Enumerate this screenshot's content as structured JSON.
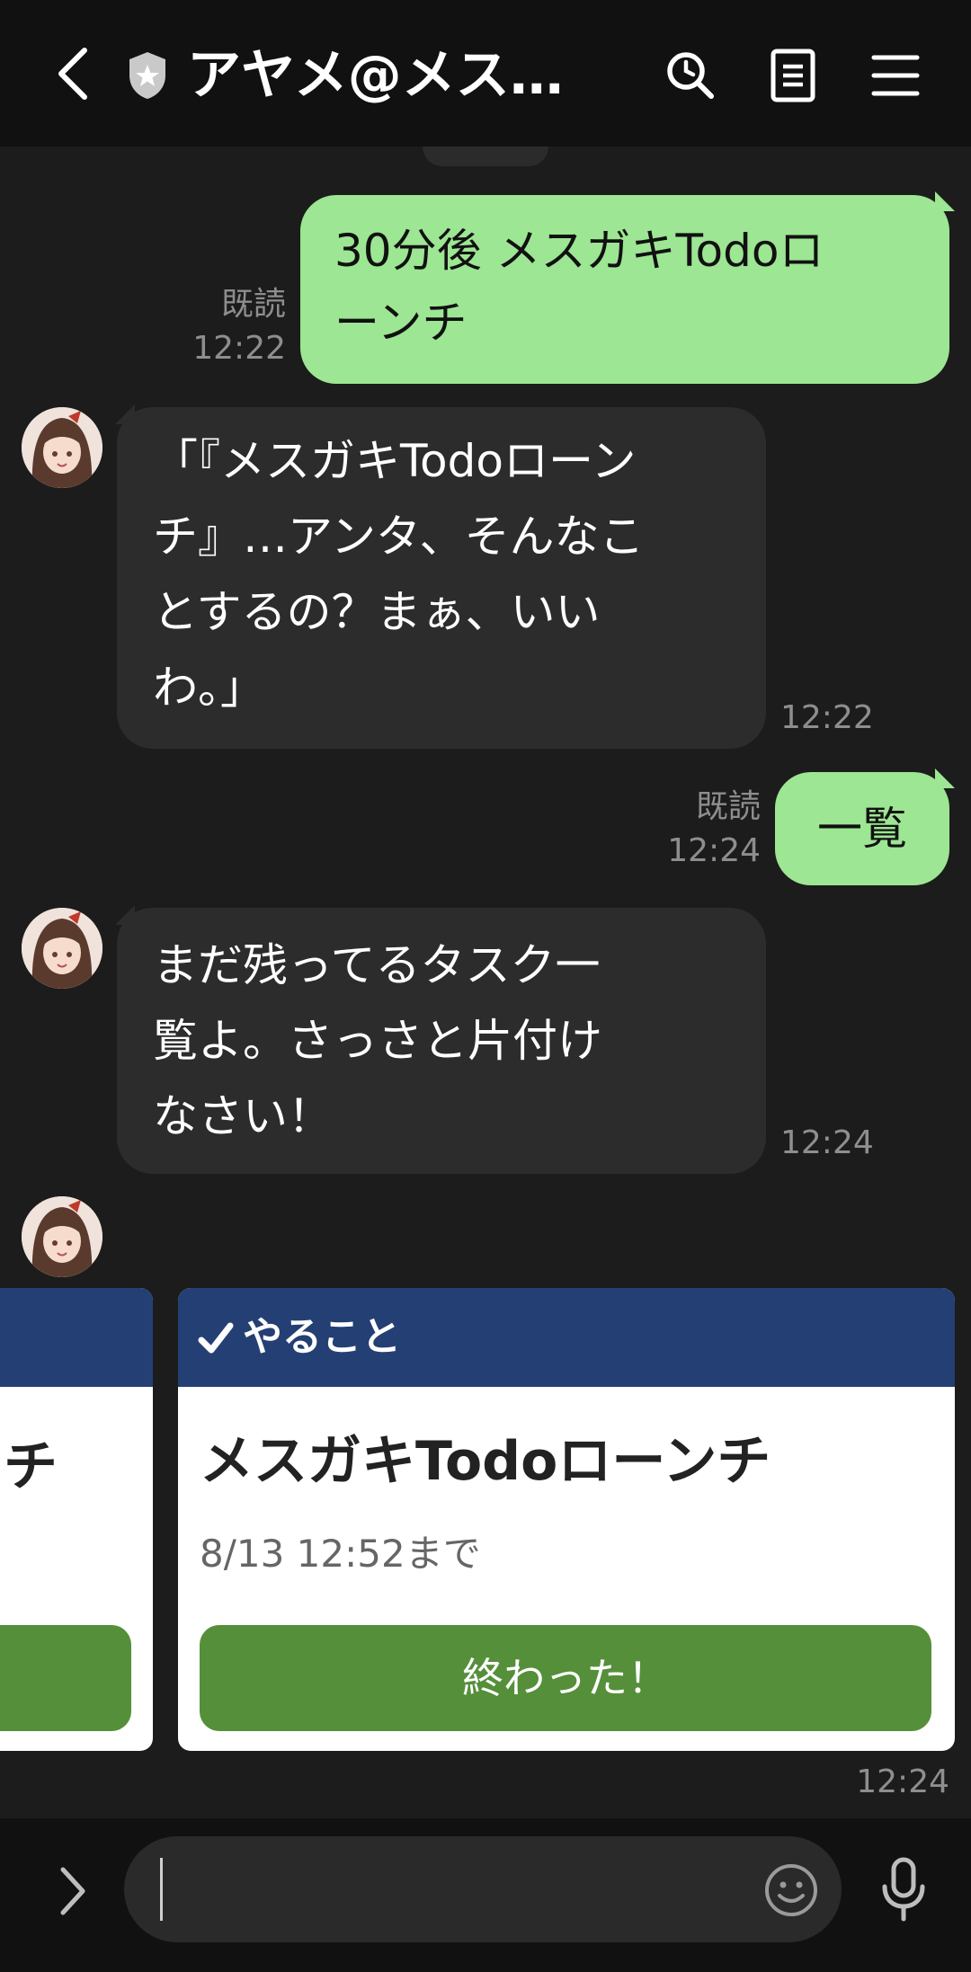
{
  "header": {
    "title": "アヤメ@メス…"
  },
  "messages": {
    "m1": {
      "line1": "30分後 メスガキTodoロ",
      "line2": "ーンチ",
      "read": "既読",
      "time": "12:22"
    },
    "m2": {
      "line1": "「『メスガキTodoローン",
      "line2": "チ』…アンタ、そんなこ",
      "line3": "とするの？まぁ、いい",
      "line4": "わ。」",
      "time": "12:22"
    },
    "m3": {
      "text": "一覧",
      "read": "既読",
      "time": "12:24"
    },
    "m4": {
      "line1": "まだ残ってるタスク一",
      "line2": "覧よ。さっさと片付け",
      "line3": "なさい！",
      "time": "12:24"
    }
  },
  "carousel": {
    "prev_title_fragment": "チ",
    "card": {
      "header": "やること",
      "title": "メスガキTodoローンチ",
      "due": "8/13 12:52まで",
      "button": "終わった！"
    },
    "time": "12:24"
  },
  "colors": {
    "outgoing_bubble": "#9de693",
    "incoming_bubble": "#2c2c2c",
    "card_header": "#243f73",
    "card_button": "#558f3a"
  },
  "icons": [
    "back-chevron-icon",
    "shield-star-icon",
    "search-icon",
    "notes-icon",
    "menu-icon",
    "expand-chevron-icon",
    "emoji-icon",
    "mic-icon"
  ]
}
